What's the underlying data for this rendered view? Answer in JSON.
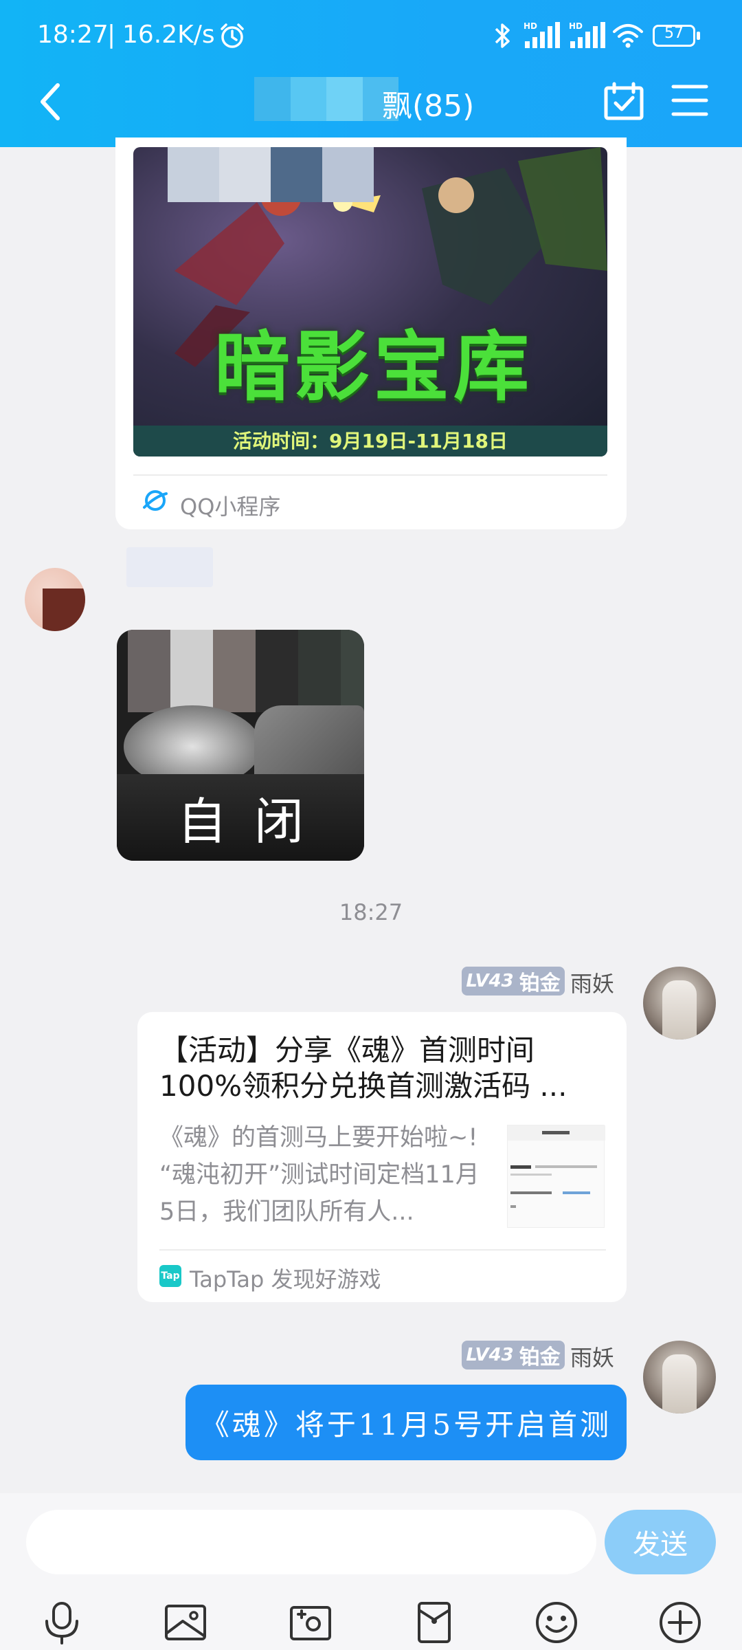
{
  "status_bar": {
    "time": "18:27",
    "net_speed": "16.2K/s",
    "battery": "57"
  },
  "header": {
    "title": "飘(85)"
  },
  "messages": {
    "mini_program": {
      "game_title": "暗影宝库",
      "event_time": "活动时间：9月19日-11月18日",
      "source": "QQ小程序"
    },
    "sticker": {
      "caption": "自闭"
    },
    "timestamp": "18:27",
    "link_card": {
      "sender_level": "LV43",
      "sender_rank": "铂金",
      "sender_name": "雨妖",
      "title": "【活动】分享《魂》首测时间100%领积分兑换首测激活码 ...",
      "description": "《魂》的首测马上要开始啦~! “魂沌初开”测试时间定档11月5日，我们团队所有人...",
      "source_logo": "Tap",
      "source": "TapTap 发现好游戏"
    },
    "text_message": {
      "sender_level": "LV43",
      "sender_rank": "铂金",
      "sender_name": "雨妖",
      "text": "《魂》将于11月5号开启首测"
    }
  },
  "input": {
    "send_label": "发送"
  },
  "colors": {
    "header": "#12b4f6",
    "bubble": "#1d8ff5",
    "send_button": "#8ccdf9",
    "badge": "#aab4c9"
  }
}
